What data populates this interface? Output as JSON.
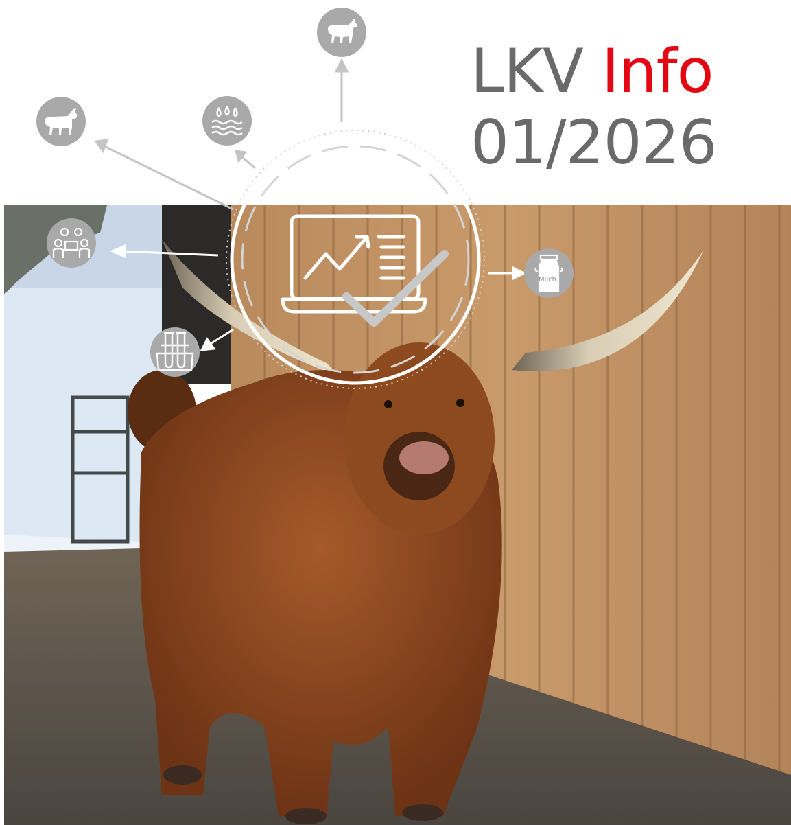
{
  "header": {
    "brand": "LKV",
    "highlight": "Info",
    "issue": "01/2026"
  },
  "icons": {
    "goat_top": "goat-icon",
    "goat_left": "goat-icon",
    "water": "water-drops-icon",
    "meeting": "meeting-people-icon",
    "milk_can": "milk-can-icon",
    "lab": "test-tubes-icon",
    "center": "laptop-chart-check-icon",
    "milk_can_label": "Milch"
  },
  "colors": {
    "accent": "#e30613",
    "title_gray": "#6a6a6a",
    "icon_gray": "#a9a9a9"
  }
}
